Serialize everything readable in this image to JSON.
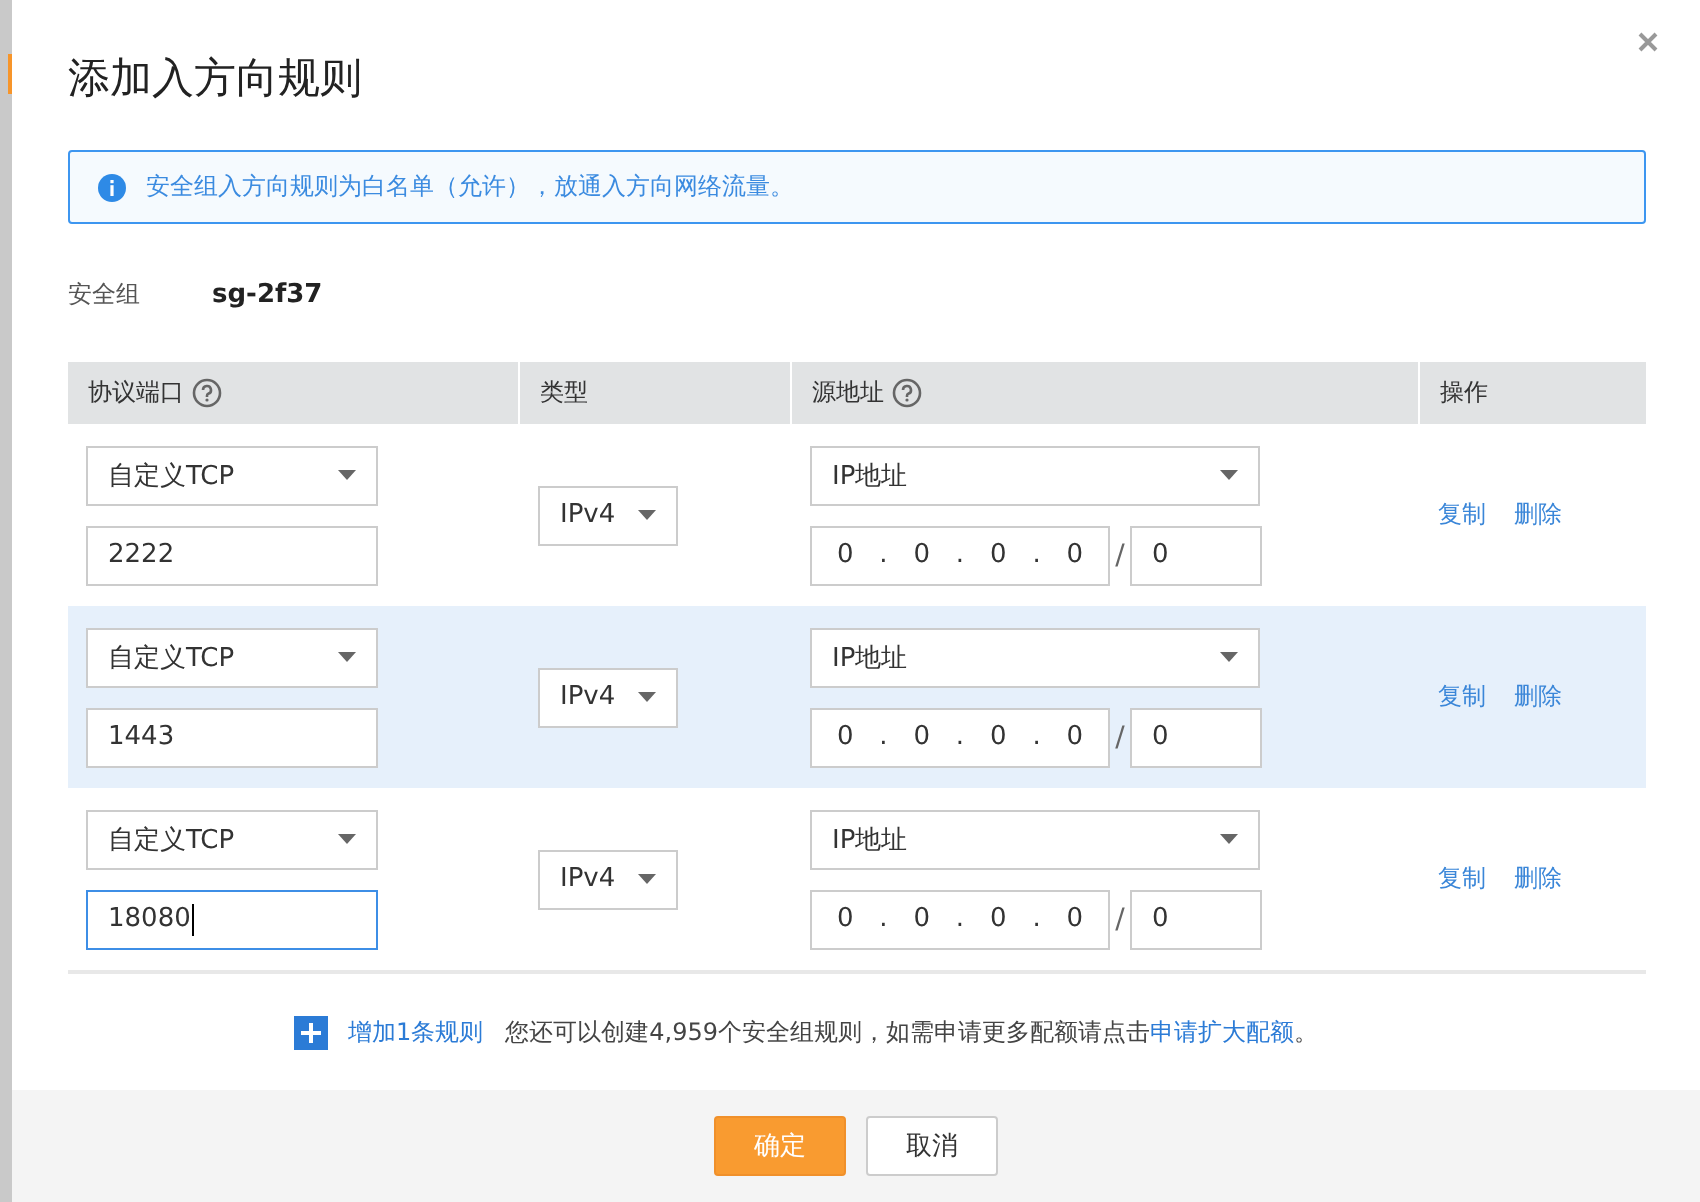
{
  "dialog": {
    "title": "添加入方向规则",
    "info": "安全组入方向规则为白名单（允许），放通入方向网络流量。",
    "group_label": "安全组",
    "group_value": "sg-2f37"
  },
  "table": {
    "columns": [
      {
        "label": "协议端口",
        "help": true
      },
      {
        "label": "类型",
        "help": false
      },
      {
        "label": "源地址",
        "help": true
      },
      {
        "label": "操作",
        "help": false
      }
    ],
    "rows": [
      {
        "protocol": "自定义TCP",
        "port": "2222",
        "port_focused": false,
        "ip_type": "IPv4",
        "source": "IP地址",
        "ip": [
          "0",
          "0",
          "0",
          "0"
        ],
        "mask": "0",
        "highlighted": false,
        "actions": [
          "复制",
          "删除"
        ]
      },
      {
        "protocol": "自定义TCP",
        "port": "1443",
        "port_focused": false,
        "ip_type": "IPv4",
        "source": "IP地址",
        "ip": [
          "0",
          "0",
          "0",
          "0"
        ],
        "mask": "0",
        "highlighted": true,
        "actions": [
          "复制",
          "删除"
        ]
      },
      {
        "protocol": "自定义TCP",
        "port": "18080",
        "port_focused": true,
        "ip_type": "IPv4",
        "source": "IP地址",
        "ip": [
          "0",
          "0",
          "0",
          "0"
        ],
        "mask": "0",
        "highlighted": false,
        "actions": [
          "复制",
          "删除"
        ]
      }
    ],
    "ip_separator": ".",
    "mask_separator": "/"
  },
  "add_rule": {
    "label": "增加1条规则",
    "note_before": "您还可以创建4,959个安全组规则，如需申请更多配额请点击",
    "note_link": "申请扩大配额",
    "note_after": "。"
  },
  "buttons": [
    {
      "label": "确定",
      "kind": "primary"
    },
    {
      "label": "取消",
      "kind": "secondary"
    }
  ]
}
